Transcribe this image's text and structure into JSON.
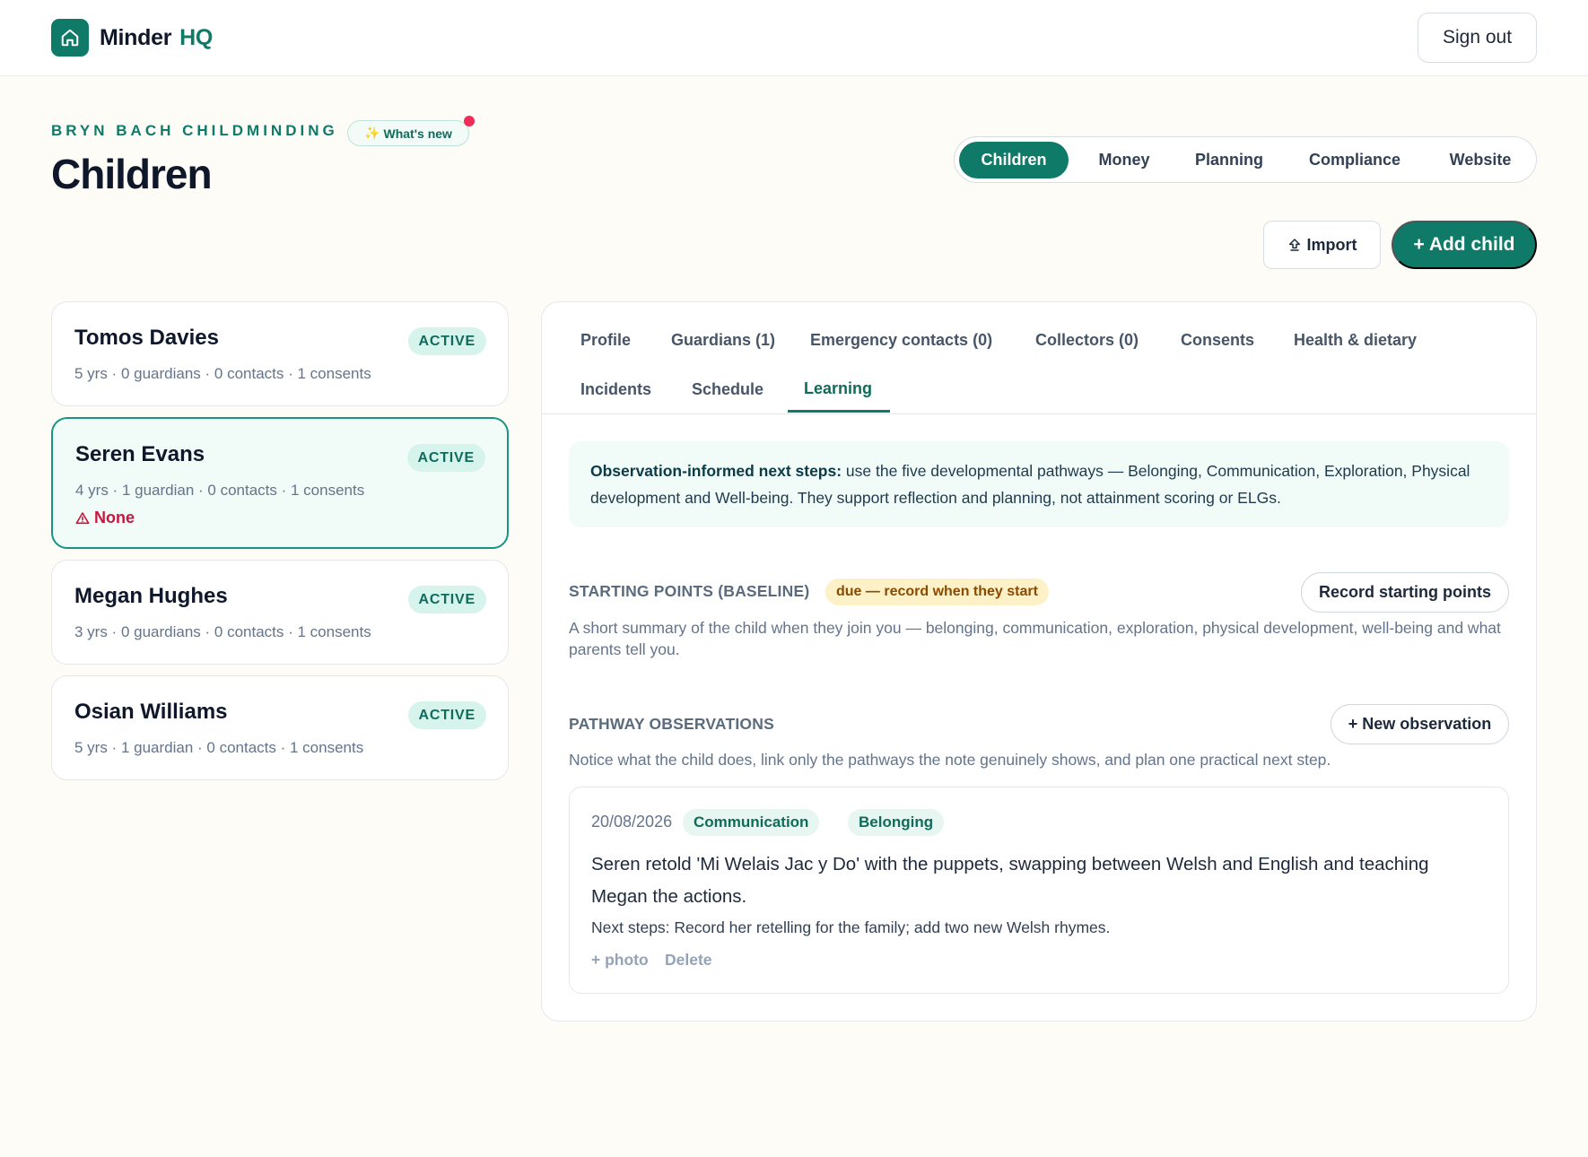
{
  "app": {
    "name": "Minder",
    "suffix": "HQ",
    "sign_out_label": "Sign out"
  },
  "header": {
    "eyebrow": "BRYN BACH CHILDMINDING",
    "whats_new": "What's new",
    "title": "Children"
  },
  "nav": {
    "items": [
      {
        "label": "Children",
        "active": true
      },
      {
        "label": "Money",
        "active": false
      },
      {
        "label": "Planning",
        "active": false
      },
      {
        "label": "Compliance",
        "active": false
      },
      {
        "label": "Website",
        "active": false
      }
    ]
  },
  "actions": {
    "import_label": "Import",
    "add_child_label": "+ Add child"
  },
  "children": [
    {
      "name": "Tomos Davies",
      "status": "ACTIVE",
      "meta": "5 yrs · 0 guardians · 0 contacts · 1 consents"
    },
    {
      "name": "Seren Evans",
      "status": "ACTIVE",
      "meta": "4 yrs · 1 guardian · 0 contacts · 1 consents",
      "alert": "None",
      "selected": true
    },
    {
      "name": "Megan Hughes",
      "status": "ACTIVE",
      "meta": "3 yrs · 0 guardians · 0 contacts · 1 consents"
    },
    {
      "name": "Osian Williams",
      "status": "ACTIVE",
      "meta": "5 yrs · 1 guardian · 0 contacts · 1 consents"
    }
  ],
  "detail": {
    "tabs": [
      "Profile",
      "Guardians (1)",
      "Emergency contacts (0)",
      "Collectors (0)",
      "Consents",
      "Health & dietary",
      "Incidents",
      "Schedule",
      "Learning"
    ],
    "active_tab": "Learning",
    "info": {
      "lead": "Observation-informed next steps:",
      "body": " use the five developmental pathways — Belonging, Communication, Exploration, Physical development and Well-being. They support reflection and planning, not attainment scoring or ELGs."
    },
    "starting_points": {
      "title": "STARTING POINTS (BASELINE)",
      "due_label": "due — record when they start",
      "button_label": "Record starting points",
      "description": "A short summary of the child when they join you — belonging, communication, exploration, physical development, well-being and what parents tell you."
    },
    "pathway_observations": {
      "title": "PATHWAY OBSERVATIONS",
      "button_label": "+ New observation",
      "description": "Notice what the child does, link only the pathways the note genuinely shows, and plan one practical next step."
    },
    "observation": {
      "date": "20/08/2026",
      "tags": [
        "Communication",
        "Belonging"
      ],
      "text": "Seren retold 'Mi Welais Jac y Do' with the puppets, swapping between Welsh and English and teaching Megan the actions.",
      "next_steps": "Next steps: Record her retelling for the family; add two new Welsh rhymes.",
      "photo_label": "+ photo",
      "delete_label": "Delete"
    }
  },
  "colors": {
    "brand": "#0f7a68",
    "alert": "#c8163e",
    "due_bg": "#fdf1c7"
  }
}
